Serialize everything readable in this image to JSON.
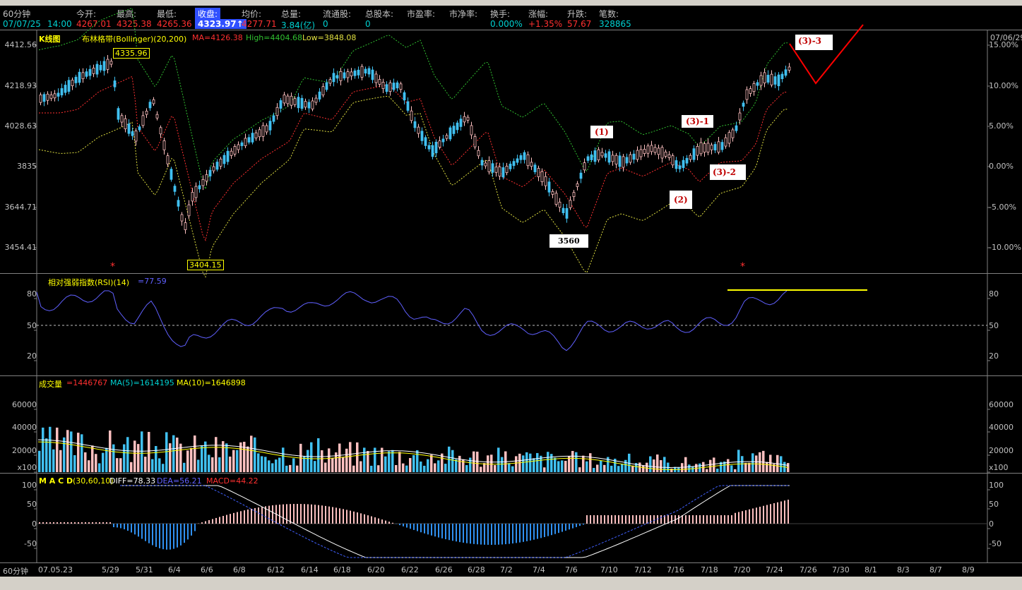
{
  "quote": {
    "period_label": "60分钟",
    "datetime_date": "07/07/25",
    "datetime_time": "14:00",
    "fields": [
      {
        "label": "今开:",
        "value": "4267.01",
        "color": "#ff3030"
      },
      {
        "label": "最高:",
        "value": "4325.38",
        "color": "#ff3030"
      },
      {
        "label": "最低:",
        "value": "4265.36",
        "color": "#ff3030"
      },
      {
        "label": "收盘:",
        "value": "4323.97↑",
        "color": "#ff3030",
        "highlight": true
      },
      {
        "label": "均价:",
        "value": "4277.71",
        "color": "#ff3030"
      },
      {
        "label": "总量:",
        "value": "3.84(亿)",
        "color": "#00d0d0"
      },
      {
        "label": "流通股:",
        "value": "0",
        "color": "#00d0d0"
      },
      {
        "label": "总股本:",
        "value": "0",
        "color": "#00d0d0"
      },
      {
        "label": "市盈率:",
        "value": "",
        "color": "#00d0d0"
      },
      {
        "label": "市净率:",
        "value": "",
        "color": "#00d0d0"
      },
      {
        "label": "换手:",
        "value": "0.000%",
        "color": "#00d0d0"
      },
      {
        "label": "涨幅:",
        "value": "+1.35%",
        "color": "#ff3030"
      },
      {
        "label": "升跌:",
        "value": "57.67",
        "color": "#ff3030"
      },
      {
        "label": "笔数:",
        "value": "328865",
        "color": "#00d0d0"
      }
    ]
  },
  "kline_panel": {
    "title": "K线图",
    "indicator": "布林格带(Bollinger)(20,200)",
    "ma": "MA=4126.38",
    "high": "High=4404.68",
    "low": "Low=3848.08",
    "price_ticks": [
      "4412.56",
      "4218.93",
      "4028.63",
      "3835",
      "3644.71",
      "3454.41"
    ],
    "pct_ticks": [
      "15.00%",
      "10.00%",
      "5.00%",
      "0.00%",
      "-5.00%",
      "-10.00%"
    ],
    "corner_date": "07/06/29",
    "high_label": "4335.96",
    "low_label": "3404.15",
    "annotations": [
      "(1)",
      "(2)",
      "(3)-1",
      "(3)-2",
      "(3)-3",
      "3560"
    ]
  },
  "rsi_panel": {
    "title": "相对强弱指数(RSI)(14)",
    "value": "=77.59",
    "ticks": [
      "80",
      "50",
      "20"
    ]
  },
  "volume_panel": {
    "title": "成交量",
    "value": "=1446767",
    "ma5": "MA(5)=1614195",
    "ma10": "MA(10)=1646898",
    "ticks": [
      "60000",
      "40000",
      "20000",
      "x100"
    ]
  },
  "macd_panel": {
    "title": "M A C D",
    "params": "(30,60,10)",
    "diff": "DIFF=78.33",
    "dea": "DEA=56.21",
    "macd": "MACD=44.22",
    "ticks": [
      "100",
      "50",
      "0",
      "-50"
    ]
  },
  "date_axis": {
    "period_label": "60分钟",
    "dates": [
      "07.05.23",
      "5/29",
      "5/31",
      "6/4",
      "6/6",
      "6/8",
      "6/12",
      "6/14",
      "6/18",
      "6/20",
      "6/22",
      "6/26",
      "6/28",
      "7/2",
      "7/4",
      "7/6",
      "7/10",
      "7/12",
      "7/16",
      "7/18",
      "7/20",
      "7/24",
      "7/26",
      "7/30",
      "8/1",
      "8/3",
      "8/7",
      "8/9"
    ]
  },
  "colors": {
    "up": "#ffc0c0",
    "down": "#40c0f0",
    "mid_band": "#ff3030",
    "upper_band": "#30c030",
    "lower_band": "#e0e040",
    "rsi_line": "#6060ff",
    "annotation": "#c00000"
  }
}
